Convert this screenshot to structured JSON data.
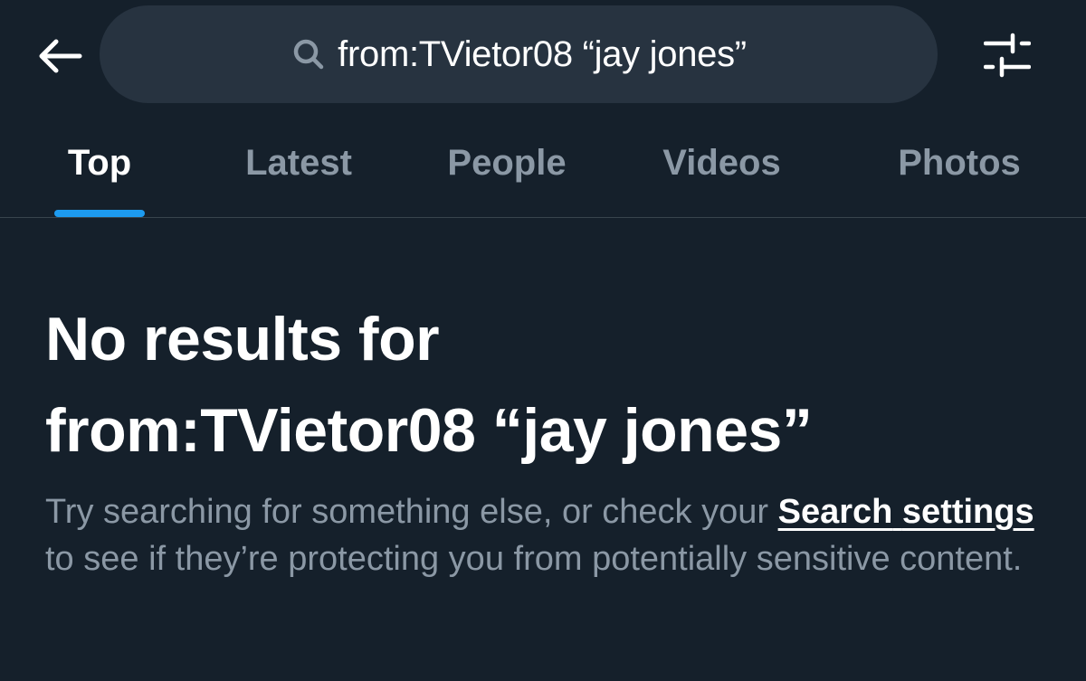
{
  "search": {
    "query": "from:TVietor08 “jay jones”"
  },
  "tabs": [
    {
      "label": "Top",
      "active": true
    },
    {
      "label": "Latest",
      "active": false
    },
    {
      "label": "People",
      "active": false
    },
    {
      "label": "Videos",
      "active": false
    },
    {
      "label": "Photos",
      "active": false
    }
  ],
  "empty_state": {
    "title_line1": "No results for",
    "title_line2": "from:TVietor08 “jay jones”",
    "desc_prefix": "Try searching for something else, or check your ",
    "link_line1": "Search",
    "link_line2": "settings",
    "desc_suffix": " to see if they’re protecting you from potentially sensitive content."
  },
  "icons": {
    "back": "back-arrow-icon",
    "search": "search-icon",
    "filter": "filter-sliders-icon"
  },
  "colors": {
    "background": "#15202b",
    "search_pill": "#273340",
    "accent": "#1d9bf0",
    "muted_text": "#8b98a5",
    "divider": "#38444d"
  }
}
